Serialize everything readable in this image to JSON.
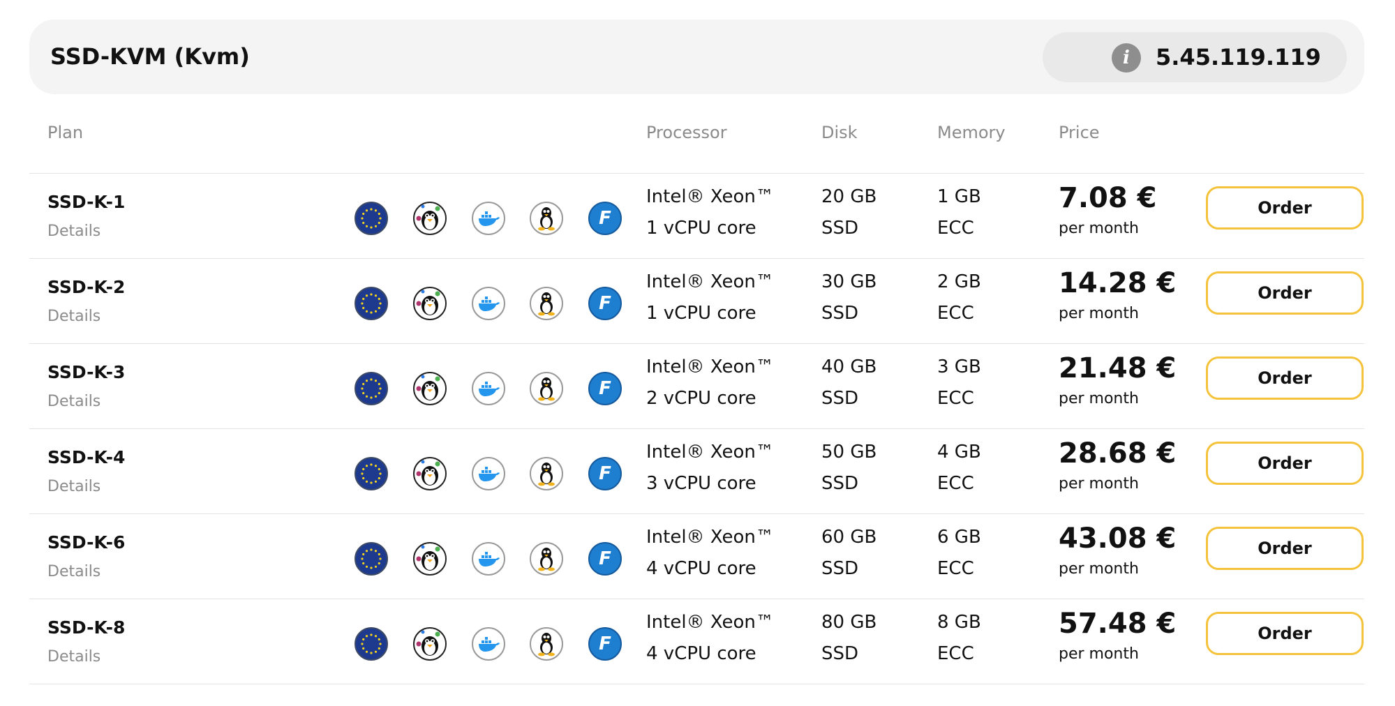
{
  "header": {
    "title": "SSD-KVM (Kvm)",
    "info_icon": "info-icon",
    "ip": "5.45.119.119"
  },
  "columns": {
    "plan": "Plan",
    "processor": "Processor",
    "disk": "Disk",
    "memory": "Memory",
    "price": "Price"
  },
  "icons": [
    "eu-flag-icon",
    "linux-penguin-icon",
    "docker-icon",
    "tux-icon",
    "f-badge-icon"
  ],
  "icon_letter": "F",
  "details_label": "Details",
  "per_label": "per month",
  "order_label": "Order",
  "colors": {
    "accent": "#f5c33b",
    "header_bg": "#f4f4f4",
    "muted": "#8a8a8a"
  },
  "plans": [
    {
      "name": "SSD-K-1",
      "cpu": "Intel® Xeon™",
      "cores": "1 vCPU core",
      "disk": "20 GB",
      "disk_type": "SSD",
      "memory": "1 GB",
      "memory_type": "ECC",
      "price": "7.08 €"
    },
    {
      "name": "SSD-K-2",
      "cpu": "Intel® Xeon™",
      "cores": "1 vCPU core",
      "disk": "30 GB",
      "disk_type": "SSD",
      "memory": "2 GB",
      "memory_type": "ECC",
      "price": "14.28 €"
    },
    {
      "name": "SSD-K-3",
      "cpu": "Intel® Xeon™",
      "cores": "2 vCPU core",
      "disk": "40 GB",
      "disk_type": "SSD",
      "memory": "3 GB",
      "memory_type": "ECC",
      "price": "21.48 €"
    },
    {
      "name": "SSD-K-4",
      "cpu": "Intel® Xeon™",
      "cores": "3 vCPU core",
      "disk": "50 GB",
      "disk_type": "SSD",
      "memory": "4 GB",
      "memory_type": "ECC",
      "price": "28.68 €"
    },
    {
      "name": "SSD-K-6",
      "cpu": "Intel® Xeon™",
      "cores": "4 vCPU core",
      "disk": "60 GB",
      "disk_type": "SSD",
      "memory": "6 GB",
      "memory_type": "ECC",
      "price": "43.08 €"
    },
    {
      "name": "SSD-K-8",
      "cpu": "Intel® Xeon™",
      "cores": "4 vCPU core",
      "disk": "80 GB",
      "disk_type": "SSD",
      "memory": "8 GB",
      "memory_type": "ECC",
      "price": "57.48 €"
    }
  ]
}
